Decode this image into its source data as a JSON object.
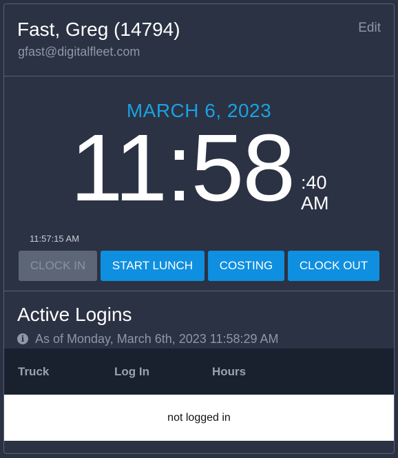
{
  "header": {
    "user_name": "Fast, Greg (14794)",
    "email": "gfast@digitalfleet.com",
    "edit_label": "Edit"
  },
  "clock": {
    "date": "MARCH 6, 2023",
    "time_main": "11:58",
    "seconds": ":40",
    "ampm": "AM",
    "last_time": "11:57:15 AM"
  },
  "actions": {
    "clock_in": "CLOCK IN",
    "start_lunch": "START LUNCH",
    "costing": "COSTING",
    "clock_out": "CLOCK OUT"
  },
  "logins": {
    "title": "Active Logins",
    "as_of": "As of Monday, March 6th, 2023 11:58:29 AM",
    "columns": [
      "Truck",
      "Log In",
      "Hours"
    ],
    "empty_message": "not logged in"
  },
  "colors": {
    "accent": "#1ba1e2",
    "button": "#0f8fe0",
    "disabled_button": "#5c6677",
    "background": "#2b3243"
  }
}
